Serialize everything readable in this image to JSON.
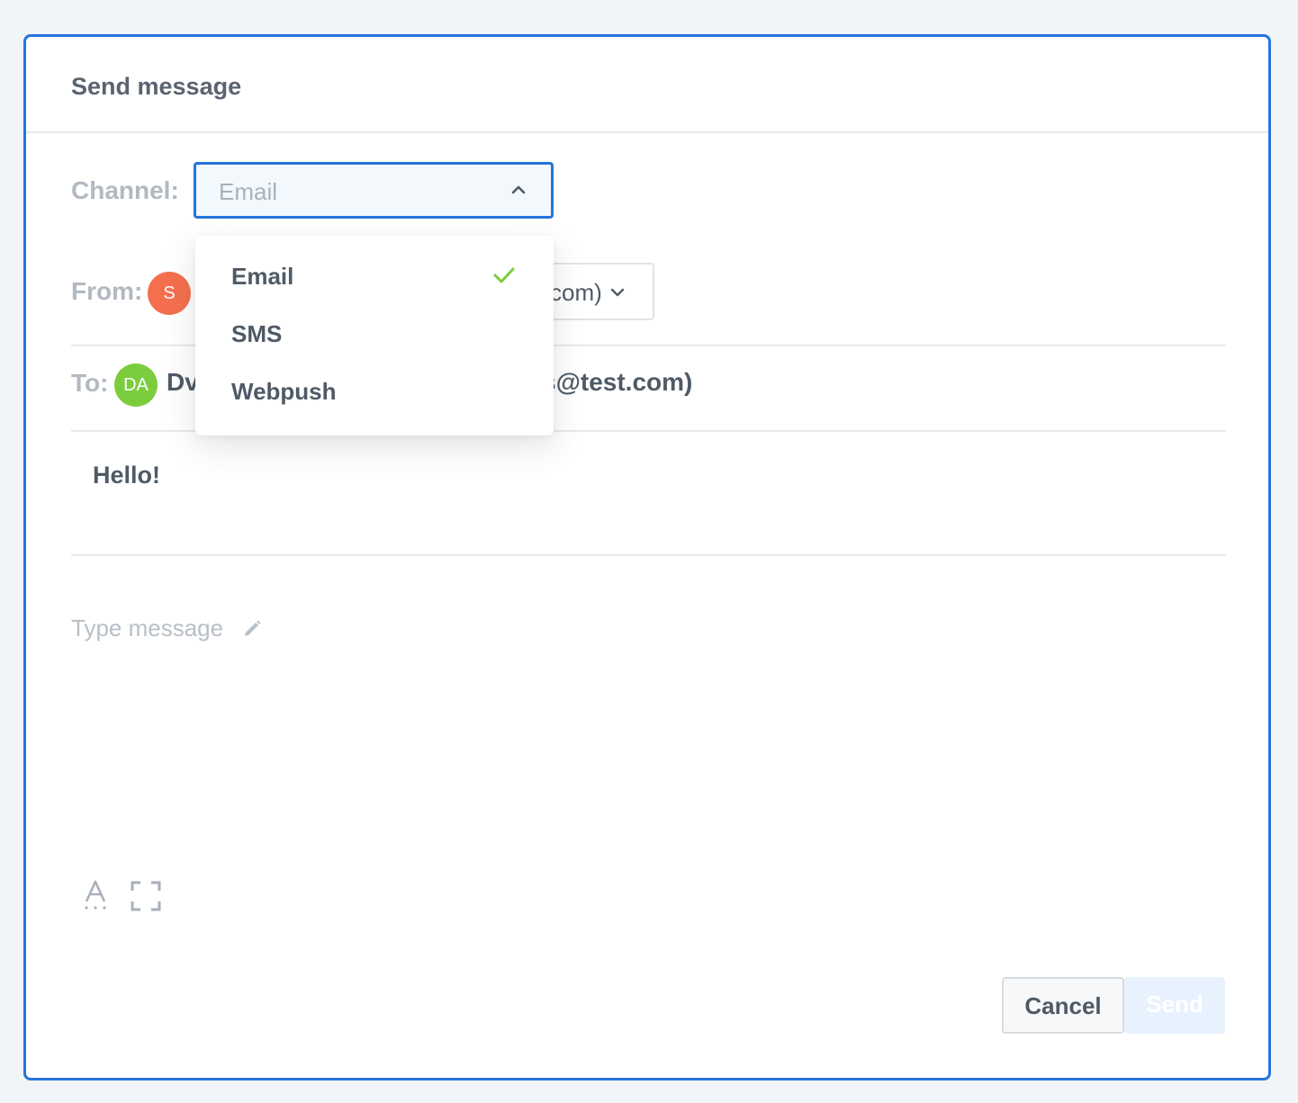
{
  "modal": {
    "title": "Send message"
  },
  "channel": {
    "label": "Channel:",
    "value": "Email",
    "options": [
      {
        "label": "Email",
        "selected": true
      },
      {
        "label": "SMS",
        "selected": false
      },
      {
        "label": "Webpush",
        "selected": false
      }
    ]
  },
  "from": {
    "label": "From:",
    "avatar_initials": "S",
    "avatar_color": "#f56f4e",
    "value_visible": "com)"
  },
  "to": {
    "label": "To:",
    "avatar_initials": "DA",
    "avatar_color": "#7ccd3d",
    "name_visible": "Dv",
    "email_visible": "s@test.com)"
  },
  "subject": {
    "value": "Hello!"
  },
  "message": {
    "placeholder": "Type message"
  },
  "toolbar": {
    "icons": [
      "text-format-icon",
      "fullscreen-icon"
    ]
  },
  "actions": {
    "cancel_label": "Cancel",
    "send_label": "Send"
  },
  "colors": {
    "accent": "#2674de",
    "check": "#7ccd3d",
    "send_disabled_bg": "#e8f2fe"
  }
}
